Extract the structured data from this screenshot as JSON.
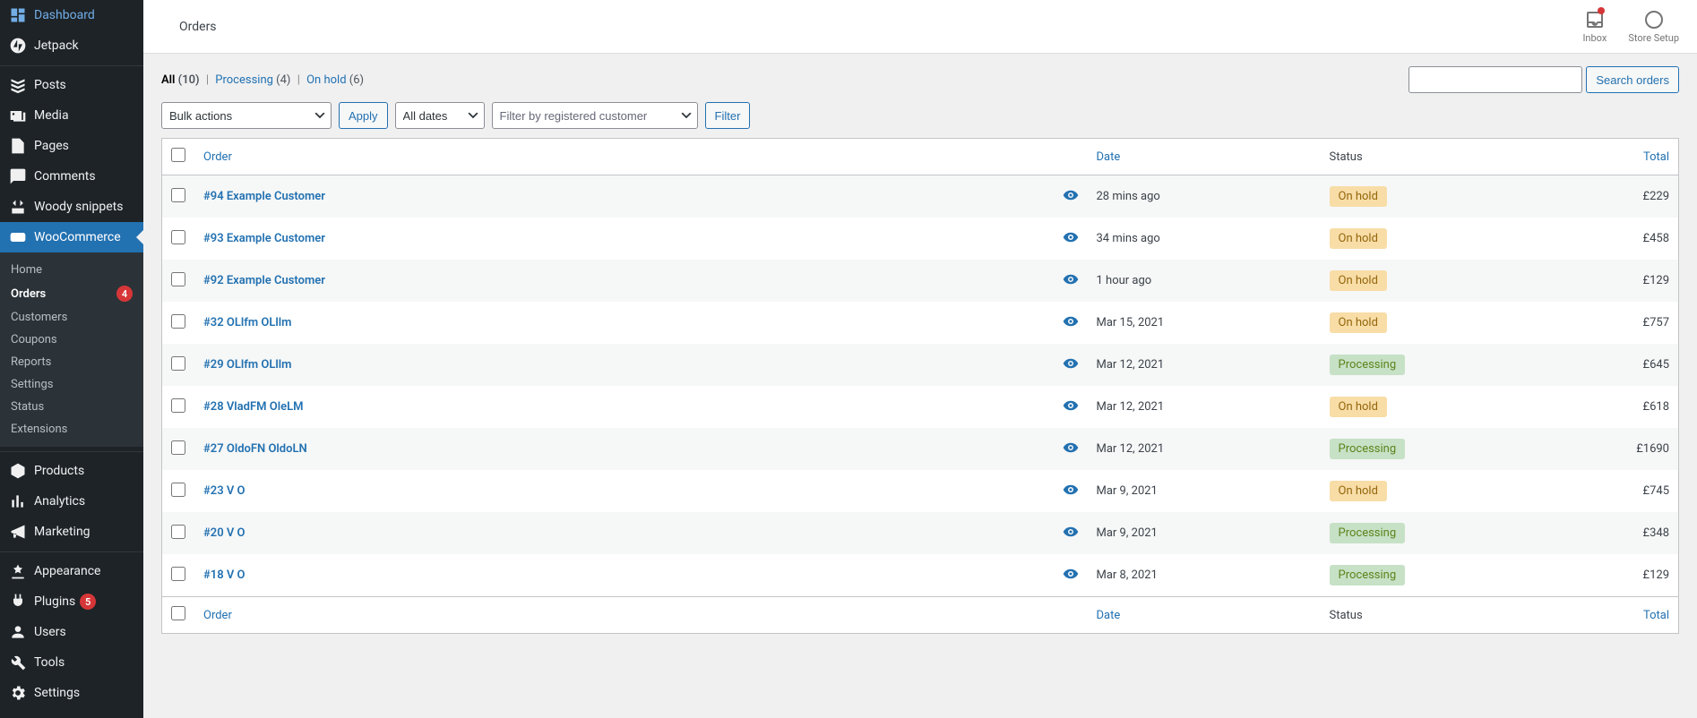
{
  "sidebar": {
    "items": [
      {
        "label": "Dashboard",
        "icon": "dashboard"
      },
      {
        "label": "Jetpack",
        "icon": "jetpack"
      },
      {
        "label": "Posts",
        "icon": "posts"
      },
      {
        "label": "Media",
        "icon": "media"
      },
      {
        "label": "Pages",
        "icon": "pages"
      },
      {
        "label": "Comments",
        "icon": "comments"
      },
      {
        "label": "Woody snippets",
        "icon": "snippets"
      },
      {
        "label": "WooCommerce",
        "icon": "woo"
      },
      {
        "label": "Products",
        "icon": "products"
      },
      {
        "label": "Analytics",
        "icon": "analytics"
      },
      {
        "label": "Marketing",
        "icon": "marketing"
      },
      {
        "label": "Appearance",
        "icon": "appearance"
      },
      {
        "label": "Plugins",
        "icon": "plugins",
        "badge": "5"
      },
      {
        "label": "Users",
        "icon": "users"
      },
      {
        "label": "Tools",
        "icon": "tools"
      },
      {
        "label": "Settings",
        "icon": "settings"
      }
    ],
    "sub": [
      {
        "label": "Home"
      },
      {
        "label": "Orders",
        "badge": "4"
      },
      {
        "label": "Customers"
      },
      {
        "label": "Coupons"
      },
      {
        "label": "Reports"
      },
      {
        "label": "Settings"
      },
      {
        "label": "Status"
      },
      {
        "label": "Extensions"
      }
    ]
  },
  "topbar": {
    "title": "Orders",
    "inbox": "Inbox",
    "store_setup": "Store Setup"
  },
  "filters": {
    "all_label": "All",
    "all_count": "(10)",
    "processing_label": "Processing",
    "processing_count": "(4)",
    "onhold_label": "On hold",
    "onhold_count": "(6)",
    "search_button": "Search orders",
    "bulk_actions": "Bulk actions",
    "apply": "Apply",
    "all_dates": "All dates",
    "customer_filter": "Filter by registered customer",
    "filter": "Filter"
  },
  "table": {
    "headers": {
      "order": "Order",
      "date": "Date",
      "status": "Status",
      "total": "Total"
    },
    "rows": [
      {
        "order": "#94 Example Customer",
        "date": "28 mins ago",
        "status": "On hold",
        "status_type": "onhold",
        "total": "£229"
      },
      {
        "order": "#93 Example Customer",
        "date": "34 mins ago",
        "status": "On hold",
        "status_type": "onhold",
        "total": "£458"
      },
      {
        "order": "#92 Example Customer",
        "date": "1 hour ago",
        "status": "On hold",
        "status_type": "onhold",
        "total": "£129"
      },
      {
        "order": "#32 OLlfm OLllm",
        "date": "Mar 15, 2021",
        "status": "On hold",
        "status_type": "onhold",
        "total": "£757"
      },
      {
        "order": "#29 OLlfm OLllm",
        "date": "Mar 12, 2021",
        "status": "Processing",
        "status_type": "processing",
        "total": "£645"
      },
      {
        "order": "#28 VladFM OleLM",
        "date": "Mar 12, 2021",
        "status": "On hold",
        "status_type": "onhold",
        "total": "£618"
      },
      {
        "order": "#27 OldoFN OldoLN",
        "date": "Mar 12, 2021",
        "status": "Processing",
        "status_type": "processing",
        "total": "£1690"
      },
      {
        "order": "#23 V O",
        "date": "Mar 9, 2021",
        "status": "On hold",
        "status_type": "onhold",
        "total": "£745"
      },
      {
        "order": "#20 V O",
        "date": "Mar 9, 2021",
        "status": "Processing",
        "status_type": "processing",
        "total": "£348"
      },
      {
        "order": "#18 V O",
        "date": "Mar 8, 2021",
        "status": "Processing",
        "status_type": "processing",
        "total": "£129"
      }
    ]
  }
}
